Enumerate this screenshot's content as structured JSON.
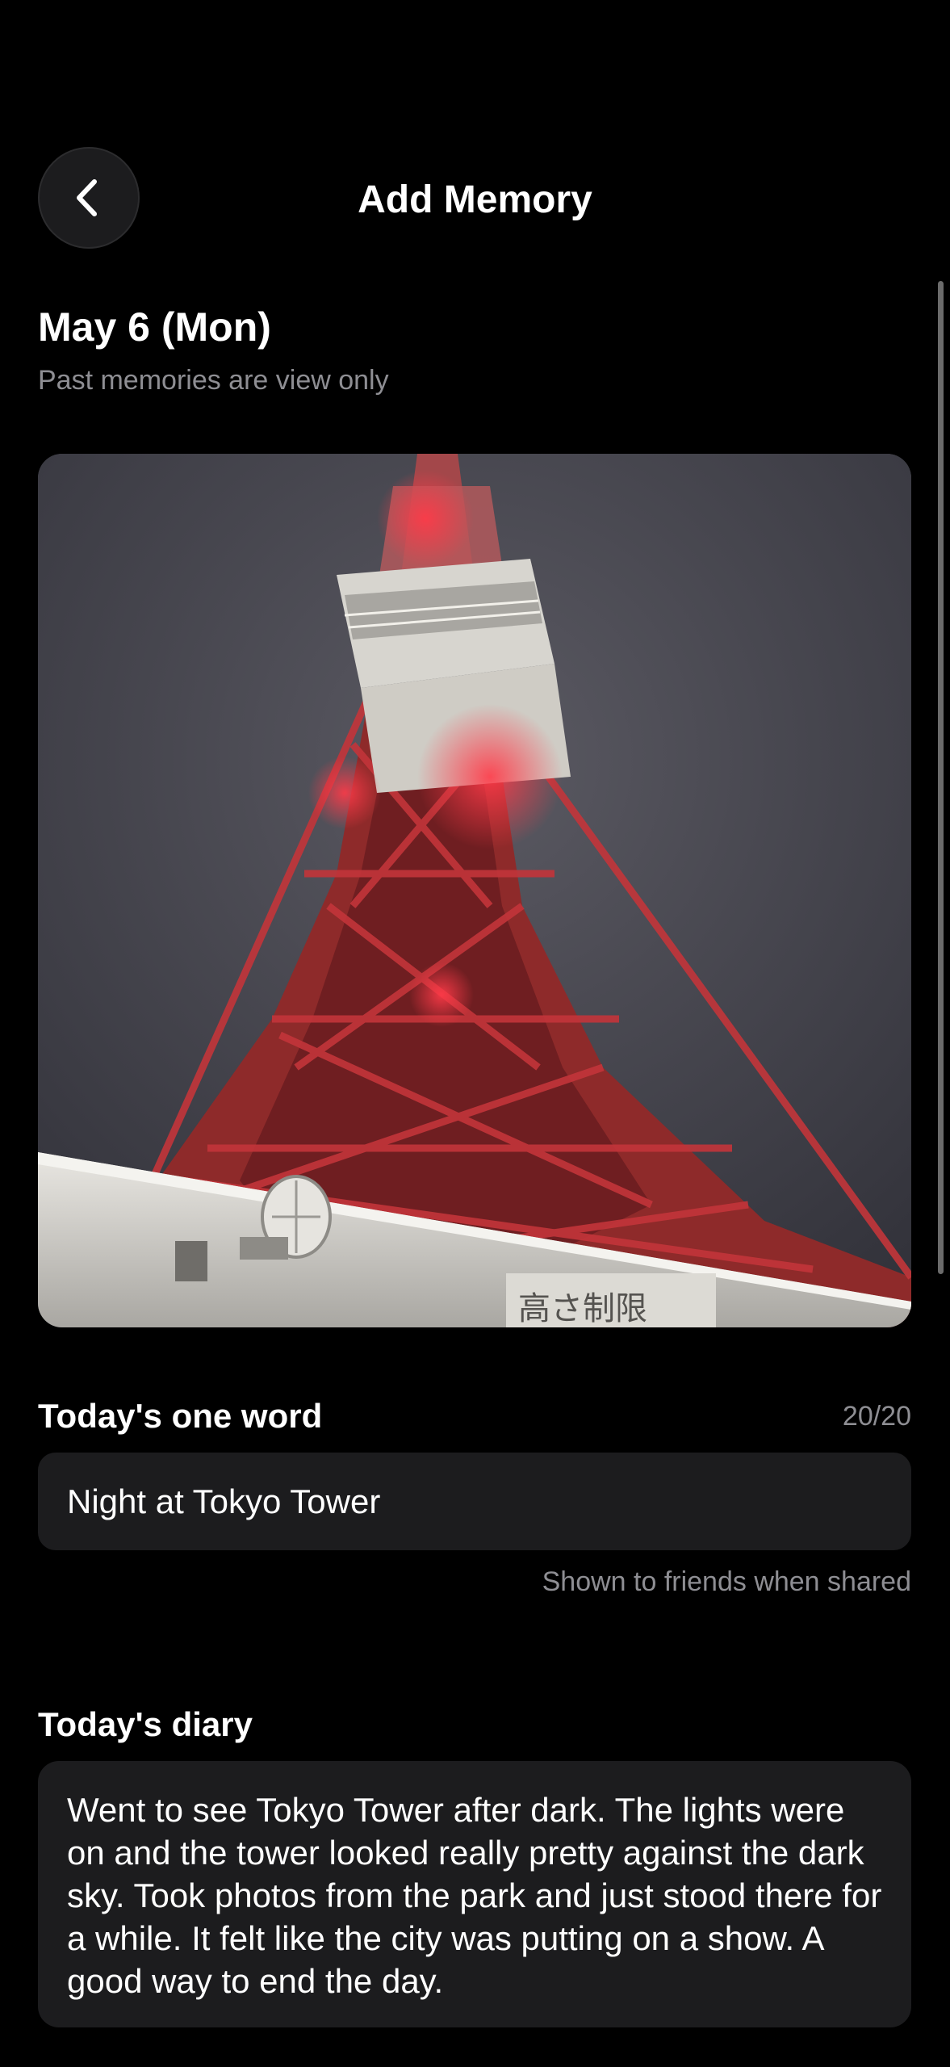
{
  "header": {
    "title": "Add Memory",
    "back_icon": "chevron-left-icon"
  },
  "entry": {
    "date": "May 6 (Mon)",
    "subtitle": "Past memories are view only"
  },
  "photo": {
    "subject": "Tokyo Tower at night",
    "accent_color": "#c8262a",
    "signage_text": "高さ制限"
  },
  "one_word": {
    "label": "Today's one word",
    "counter": "20/20",
    "value": "Night at Tokyo Tower",
    "hint": "Shown to friends when shared"
  },
  "diary": {
    "label": "Today's diary",
    "text": "Went to see Tokyo Tower after dark. The lights were on and the tower looked really pretty against the dark sky. Took photos from the park and just stood there for a while. It felt like the city was putting on a show. A good way to end the day."
  },
  "colors": {
    "background": "#000000",
    "surface": "#1c1c1e",
    "secondary_text": "#8e8e93"
  }
}
